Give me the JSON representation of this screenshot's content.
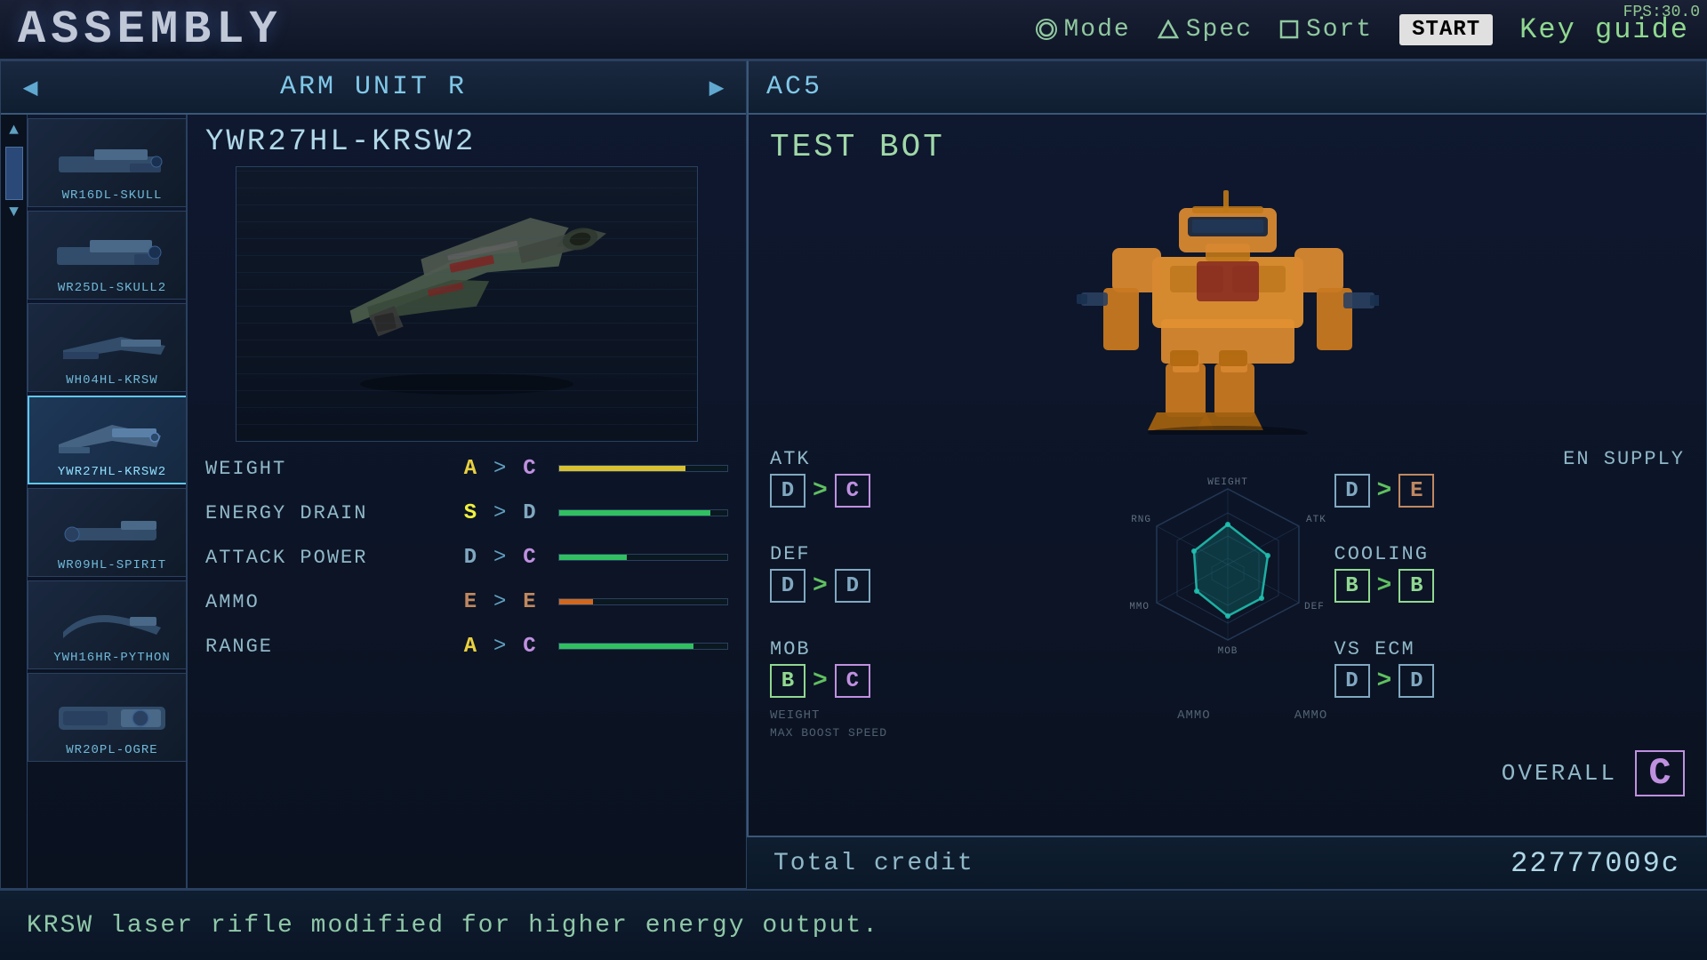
{
  "header": {
    "title": "ASSEMBLY",
    "fps": "FPS:30.0",
    "nav": [
      {
        "id": "mode",
        "icon": "circle",
        "label": "Mode"
      },
      {
        "id": "spec",
        "icon": "triangle",
        "label": "Spec"
      },
      {
        "id": "sort",
        "icon": "square",
        "label": "Sort"
      }
    ],
    "start_label": "START",
    "key_guide_label": "Key guide"
  },
  "left_panel": {
    "category": "Arm Unit R",
    "selected_item": "YWR27HL-KRSW2",
    "items": [
      {
        "id": "wr16dl-skull",
        "label": "WR16DL-SKULL",
        "selected": false
      },
      {
        "id": "wr25dl-skull2",
        "label": "WR25DL-SKULL2",
        "selected": false
      },
      {
        "id": "wh04hl-krsw",
        "label": "WH04HL-KRSW",
        "selected": false
      },
      {
        "id": "ywr27hl-krsw2",
        "label": "YWR27HL-KRSW2",
        "selected": true
      },
      {
        "id": "wr09hl-spirit",
        "label": "WR09HL-SPIRIT",
        "selected": false
      },
      {
        "id": "ywh16hr-python",
        "label": "YWH16HR-PYTHON",
        "selected": false
      },
      {
        "id": "wr20pl-ogre",
        "label": "WR20PL-OGRE",
        "selected": false
      }
    ],
    "stats": [
      {
        "label": "WEIGHT",
        "before": "A",
        "after": "C",
        "bar_pct": 75,
        "bar_color": "yellow"
      },
      {
        "label": "ENERGY DRAIN",
        "before": "S",
        "after": "D",
        "bar_pct": 90,
        "bar_color": "green"
      },
      {
        "label": "ATTACK POWER",
        "before": "D",
        "after": "C",
        "bar_pct": 40,
        "bar_color": "green"
      },
      {
        "label": "AMMO",
        "before": "E",
        "after": "E",
        "bar_pct": 20,
        "bar_color": "orange"
      },
      {
        "label": "RANGE",
        "before": "A",
        "after": "C",
        "bar_pct": 80,
        "bar_color": "green"
      }
    ]
  },
  "right_panel": {
    "section_label": "AC5",
    "ac_name": "TEST BOT",
    "stats": {
      "atk": {
        "label": "ATK",
        "before": "D",
        "after": "C"
      },
      "def": {
        "label": "DEF",
        "before": "D",
        "after": "D"
      },
      "mob": {
        "label": "MOB",
        "before": "B",
        "after": "C"
      },
      "en_supply": {
        "label": "EN SUPPLY",
        "before": "D",
        "after": "E"
      },
      "cooling": {
        "label": "COOLING",
        "before": "B",
        "after": "B"
      },
      "vs_ecm": {
        "label": "VS ECM",
        "before": "D",
        "after": "D"
      }
    },
    "overall": {
      "label": "OVERALL",
      "grade": "C"
    },
    "credit": {
      "label": "Total credit",
      "value": "22777009c"
    }
  },
  "description": "KRSW laser rifle modified for higher energy output.",
  "radar_labels": {
    "weight": "WEIGHT",
    "ammo": "AMMO",
    "atk": "ATK",
    "def": "DEF",
    "mob": "MOB"
  }
}
